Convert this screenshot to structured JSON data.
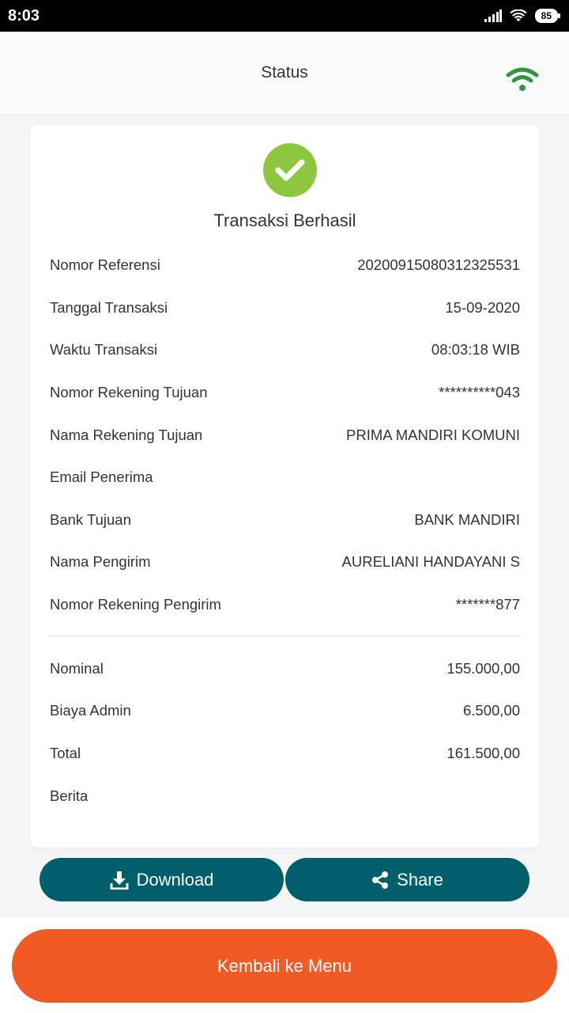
{
  "status_bar": {
    "time": "8:03",
    "battery": "85"
  },
  "header": {
    "title": "Status"
  },
  "result": {
    "title": "Transaksi Berhasil"
  },
  "details": [
    {
      "label": "Nomor Referensi",
      "value": "20200915080312325531"
    },
    {
      "label": "Tanggal Transaksi",
      "value": "15-09-2020"
    },
    {
      "label": "Waktu Transaksi",
      "value": "08:03:18 WIB"
    },
    {
      "label": "Nomor Rekening Tujuan",
      "value": "**********043"
    },
    {
      "label": "Nama Rekening Tujuan",
      "value": "PRIMA MANDIRI KOMUNI"
    },
    {
      "label": "Email Penerima",
      "value": ""
    },
    {
      "label": "Bank Tujuan",
      "value": "BANK MANDIRI"
    },
    {
      "label": "Nama Pengirim",
      "value": "AURELIANI HANDAYANI S"
    },
    {
      "label": "Nomor Rekening Pengirim",
      "value": "*******877"
    }
  ],
  "amounts": [
    {
      "label": "Nominal",
      "value": "155.000,00"
    },
    {
      "label": "Biaya Admin",
      "value": "6.500,00"
    },
    {
      "label": "Total",
      "value": "161.500,00"
    },
    {
      "label": "Berita",
      "value": ""
    }
  ],
  "actions": {
    "download_label": "Download",
    "share_label": "Share",
    "back_label": "Kembali ke Menu"
  },
  "colors": {
    "success": "#8dc63f",
    "secondary_button": "#005f6b",
    "primary_button": "#f15a24",
    "wifi_icon": "#2e9a3e"
  },
  "icons": {
    "header": "wifi-icon",
    "success": "check-icon",
    "download": "download-icon",
    "share": "share-icon"
  }
}
